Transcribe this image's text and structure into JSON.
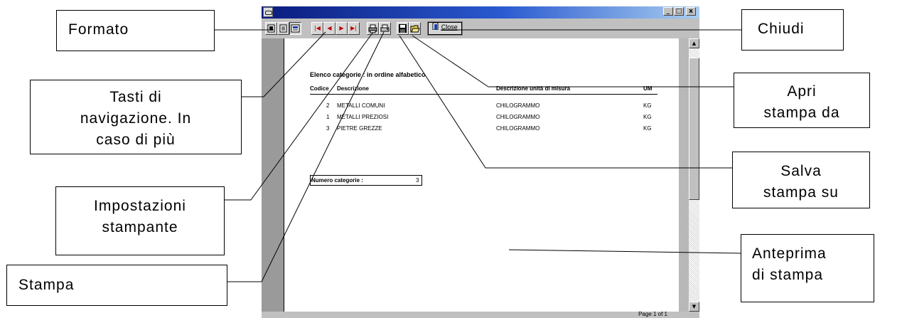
{
  "window": {
    "title_buttons": [
      "_",
      "□",
      "x"
    ],
    "toolbar": {
      "format_buttons": [
        "page-format-icon",
        "list-format-icon",
        "zoom-format-icon"
      ],
      "nav_buttons": [
        "|◀",
        "◀",
        "▶",
        "▶|"
      ],
      "close_label": "Close"
    },
    "status": "Page 1 of 1"
  },
  "report": {
    "title": "Elenco categorie : in ordine alfabetico",
    "columns": {
      "codice": "Codice",
      "descrizione": "Descrizione",
      "unita": "Descrizione unità di misura",
      "um": "UM"
    },
    "rows": [
      {
        "codice": "2",
        "descrizione": "METALLI COMUNI",
        "unita": "CHILOGRAMMO",
        "um": "KG"
      },
      {
        "codice": "1",
        "descrizione": "METALLI PREZIOSI",
        "unita": "CHILOGRAMMO",
        "um": "KG"
      },
      {
        "codice": "3",
        "descrizione": "PIETRE GREZZE",
        "unita": "CHILOGRAMMO",
        "um": "KG"
      }
    ],
    "count_label": "Numero categorie :",
    "count_value": "3"
  },
  "callouts": {
    "formato": "Formato",
    "navigazione": [
      "Tasti di",
      "navigazione. In",
      "caso di più"
    ],
    "impostazioni": [
      "Impostazioni",
      "stampante"
    ],
    "stampa": "Stampa",
    "chiudi": "Chiudi",
    "apri": [
      "Apri",
      "stampa da"
    ],
    "salva": [
      "Salva",
      "stampa su"
    ],
    "anteprima": [
      "Anteprima",
      "di stampa"
    ]
  }
}
